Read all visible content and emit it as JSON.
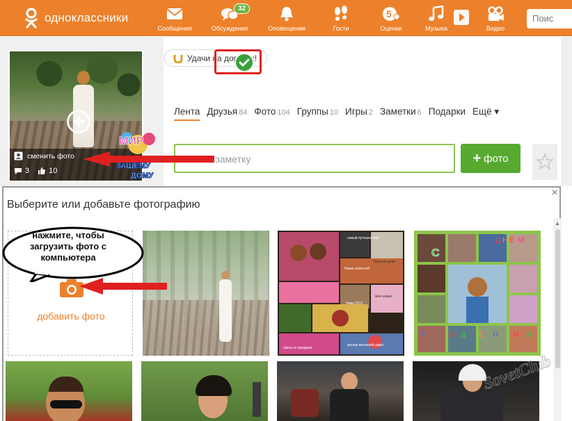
{
  "header": {
    "logo_text": "одноклассники",
    "nav": [
      {
        "label": "Сообщения",
        "icon": "envelope-icon"
      },
      {
        "label": "Обсуждения",
        "icon": "chat-bubbles-icon",
        "badge": "32"
      },
      {
        "label": "Оповещения",
        "icon": "bell-icon"
      },
      {
        "label": "Гости",
        "icon": "footprints-icon"
      },
      {
        "label": "Оценки",
        "icon": "rating-five-icon",
        "badge_glyph": "5"
      },
      {
        "label": "Музыка",
        "icon": "music-note-icon"
      },
      {
        "label": "Видео",
        "icon": "film-camera-icon"
      }
    ],
    "search_placeholder": "Поис"
  },
  "profile": {
    "change_photo": "сменить фото",
    "comments": "3",
    "likes": "10",
    "sticker_text_1": "МИР",
    "sticker_text_2": "ВАШЕМУ",
    "sticker_text_3": "ДОМУ"
  },
  "status": {
    "text": "Удачи на дорогах!"
  },
  "tabs": [
    {
      "label": "Лента",
      "count": "",
      "active": true
    },
    {
      "label": "Друзья",
      "count": "84"
    },
    {
      "label": "Фото",
      "count": "104"
    },
    {
      "label": "Группы",
      "count": "10"
    },
    {
      "label": "Игры",
      "count": "2"
    },
    {
      "label": "Заметки",
      "count": "6"
    },
    {
      "label": "Подарки",
      "count": ""
    },
    {
      "label": "Ещё ▾",
      "count": ""
    }
  ],
  "note": {
    "placeholder": "писать заметку"
  },
  "photo_button": {
    "plus": "+",
    "label": "фото"
  },
  "modal": {
    "title": "Выберите или добавьте фотографию",
    "close": "×",
    "add_photo": "добавить фото",
    "callout": "нажмите, чтобы загрузить фото с компьютера",
    "collage_b": {
      "captions": [
        "новый путешествий",
        "Крылья души",
        "Наши новостей",
        "Нива 2012",
        "мое новые",
        "желаю весенний дарю",
        "Цветы в праздник"
      ]
    },
    "collage_c": {
      "letters": [
        "С",
        "Д",
        "Н",
        "Ё",
        "М",
        "Р",
        "Ж",
        "Д",
        "Е",
        "Н",
        "И",
        "Я"
      ]
    }
  },
  "watermark": {
    "text": "SovetClub"
  },
  "colors": {
    "brand_orange": "#ed812b",
    "accent_green": "#58a92f",
    "input_border_green": "#8ac44f",
    "annotation_red": "#e02020",
    "check_green": "#3aa13a"
  }
}
